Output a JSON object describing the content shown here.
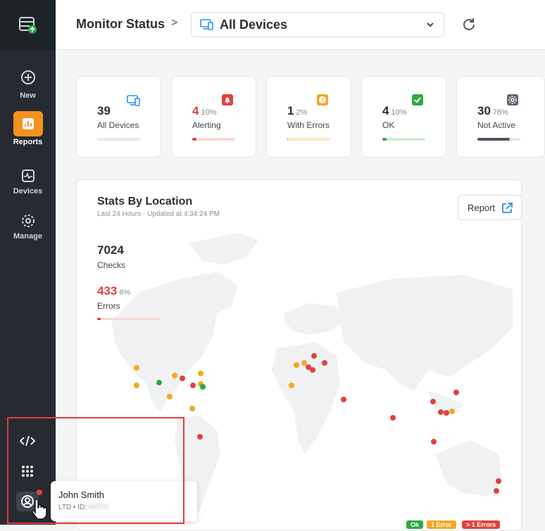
{
  "sidebar": {
    "items": [
      {
        "label": "New",
        "icon": "plus-circle-icon"
      },
      {
        "label": "Reports",
        "icon": "chart-icon",
        "active": true
      },
      {
        "label": "Devices",
        "icon": "devices-icon"
      },
      {
        "label": "Manage",
        "icon": "gear-icon"
      }
    ],
    "bottom": [
      {
        "icon": "code-icon"
      },
      {
        "icon": "apps-grid-icon"
      },
      {
        "icon": "user-icon"
      }
    ]
  },
  "header": {
    "title": "Monitor Status",
    "separator": ">",
    "device_select": "All Devices"
  },
  "cards": [
    {
      "value": "39",
      "pct": "",
      "label": "All Devices",
      "fill": 0,
      "color": "#2a8fe0",
      "track": "#e6e8eb"
    },
    {
      "value": "4",
      "pct": "10%",
      "label": "Alerting",
      "fill": 0.1,
      "color": "#e0423b",
      "track": "#fbd5d3"
    },
    {
      "value": "1",
      "pct": "2%",
      "label": "With Errors",
      "fill": 0.02,
      "color": "#f5a623",
      "track": "#fde7c4"
    },
    {
      "value": "4",
      "pct": "10%",
      "label": "OK",
      "fill": 0.1,
      "color": "#2ea844",
      "track": "#cfeed5"
    },
    {
      "value": "30",
      "pct": "76%",
      "label": "Not Active",
      "fill": 0.76,
      "color": "#4a5560",
      "track": "#e6e8eb"
    }
  ],
  "stats": {
    "title": "Stats By Location",
    "subtitle": "Last 24 Hours · Updated at 4:34:24 PM",
    "report_button": "Report",
    "checks": "7024",
    "checks_label": "Checks",
    "errors": "433",
    "errors_pct": "6%",
    "errors_label": "Errors",
    "errors_fill": 0.06,
    "legend": [
      "Ok",
      "1 Error",
      "> 1 Errors"
    ]
  },
  "user": {
    "name": "John Smith",
    "org": "LTD • ID:",
    "id": "#8379"
  },
  "colors": {
    "accent": "#f5921e",
    "error": "#e0423b",
    "warn": "#f5a623",
    "ok": "#2ea844"
  }
}
